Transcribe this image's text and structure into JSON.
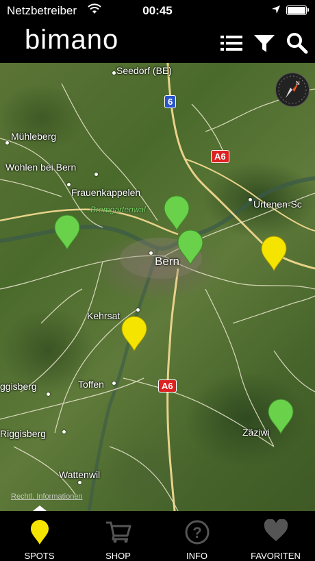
{
  "status_bar": {
    "carrier": "Netzbetreiber",
    "time": "00:45"
  },
  "header": {
    "title": "bimano"
  },
  "map": {
    "places": [
      {
        "key": "seedorf",
        "label": "Seedorf (BE)"
      },
      {
        "key": "muehleberg",
        "label": "Mühleberg"
      },
      {
        "key": "wohlen",
        "label": "Wohlen bei Bern"
      },
      {
        "key": "frauenkappelen",
        "label": "Frauenkappelen"
      },
      {
        "key": "urtenen",
        "label": "Urtenen-Sc"
      },
      {
        "key": "bern",
        "label": "Bern"
      },
      {
        "key": "kehrsatz",
        "label": "Kehrsat"
      },
      {
        "key": "toffen",
        "label": "Toffen"
      },
      {
        "key": "riggisberg",
        "label": "Riggisberg"
      },
      {
        "key": "rueggisberg",
        "label": "ggisberg"
      },
      {
        "key": "zaeziwil",
        "label": "Zäziwi"
      },
      {
        "key": "wattenwil",
        "label": "Wattenwil"
      }
    ],
    "forest_label": "Bremgartenwal",
    "highway_6": "6",
    "highway_a6_north": "A6",
    "highway_a6_south": "A6",
    "legal_text": "Rechtl. Informationen",
    "pin_colors": {
      "green": "#6ad14a",
      "yellow": "#f5e400"
    }
  },
  "tabs": [
    {
      "label": "SPOTS",
      "icon": "spot-pin-icon",
      "active": true
    },
    {
      "label": "SHOP",
      "icon": "cart-icon",
      "active": false
    },
    {
      "label": "INFO",
      "icon": "question-icon",
      "active": false
    },
    {
      "label": "FAVORITEN",
      "icon": "heart-icon",
      "active": false
    }
  ]
}
